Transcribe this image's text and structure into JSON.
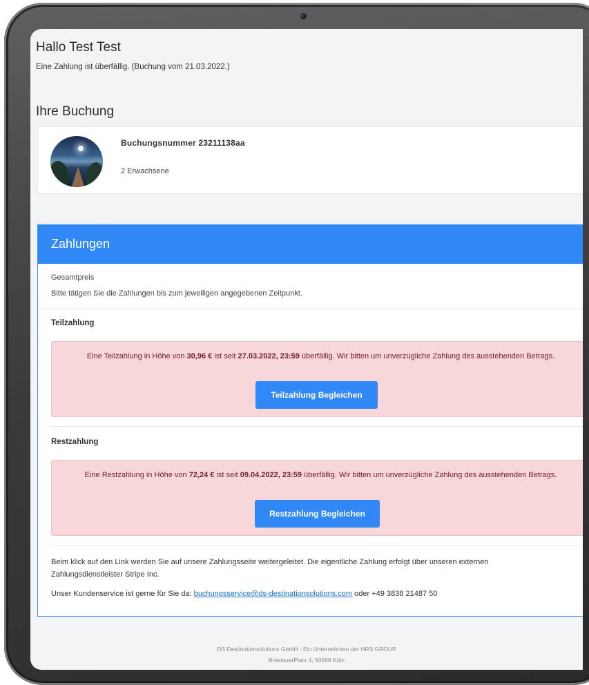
{
  "greeting": "Hallo Test Test",
  "overdue_note": "Eine Zahlung ist überfällig. (Buchung vom 21.03.2022.)",
  "booking_section_title": "Ihre Buchung",
  "booking": {
    "number_label": "Buchungsnummer 23211138aa",
    "guests": "2 Erwachsene"
  },
  "payments": {
    "title": "Zahlungen",
    "total_label": "Gesamtpreis",
    "instruction": "Bitte tätigen Sie die Zahlungen bis zum jeweiligen angegebenen Zeitpunkt.",
    "partial": {
      "heading": "Teilzahlung",
      "text_before_amount": "Eine Teilzahlung in Höhe von ",
      "amount": "30,96 €",
      "text_before_date": " ist seit ",
      "due": "27.03.2022, 23:59",
      "text_after": " überfällig. Wir bitten um unverzügliche Zahlung des ausstehenden Betrags.",
      "button_label": "Teilzahlung Begleichen"
    },
    "remaining": {
      "heading": "Restzahlung",
      "text_before_amount": "Eine Restzahlung in Höhe von ",
      "amount": "72,24 €",
      "text_before_date": " ist seit ",
      "due": "09.04.2022, 23:59",
      "text_after": " überfällig. Wir bitten um unverzügliche Zahlung des ausstehenden Betrags.",
      "button_label": "Restzahlung Begleichen"
    },
    "redirect_note": "Beim klick auf den Link werden Sie auf unsere Zahlungsseite weitergeleitet. Die eigentliche Zahlung erfolgt über unseren externen Zahlungsdienstleister Stripe Inc.",
    "contact_prefix": "Unser Kundenservice ist gerne für Sie da: ",
    "contact_email": "buchungsservice@ds-destinationsolutions.com",
    "contact_suffix": " oder +49 3838 21487 50"
  },
  "footer": {
    "company": "DS Destinationsolutions GmbH - Ein Unternehmen der HRS GROUP",
    "address": "BreslauerPlatz 4, 50668 Köln"
  },
  "colors": {
    "accent": "#2f88f5",
    "alert_bg": "#f8d7da",
    "alert_text": "#721c24",
    "link": "#1a6fd4"
  }
}
